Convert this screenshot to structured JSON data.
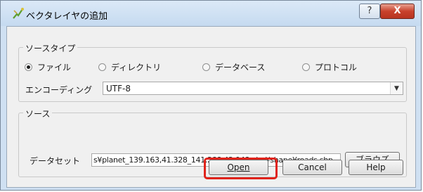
{
  "window": {
    "title": "ベクタレイヤの追加",
    "help_label": "?",
    "close_label": "X"
  },
  "source_type": {
    "group_label": "ソースタイプ",
    "options": [
      {
        "label": "ファイル",
        "checked": true
      },
      {
        "label": "ディレクトリ",
        "checked": false
      },
      {
        "label": "データベース",
        "checked": false
      },
      {
        "label": "プロトコル",
        "checked": false
      }
    ],
    "encoding_label": "エンコーディング",
    "encoding_value": "UTF-8"
  },
  "source": {
    "group_label": "ソース",
    "dataset_label": "データセット",
    "dataset_value": "s¥planet_139.163,41.328_141.288,42.948-shp¥shape¥roads.shp",
    "browse_label": "ブラウズ"
  },
  "buttons": {
    "open_label": "Open",
    "cancel_label": "Cancel",
    "help_label": "Help"
  },
  "annotation": {
    "highlight_color": "#e0231b"
  }
}
